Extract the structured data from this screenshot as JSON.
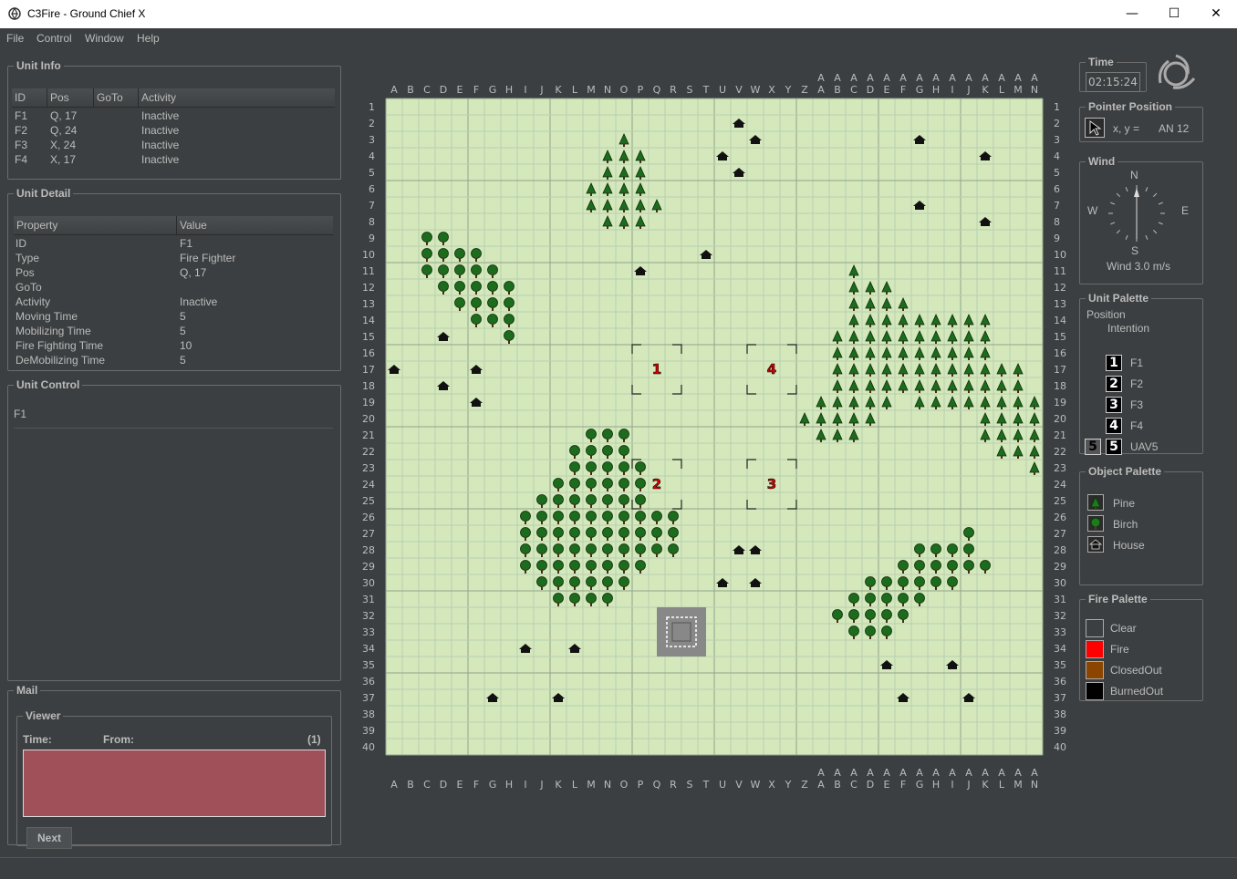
{
  "window": {
    "title": "C3Fire - Ground Chief X",
    "minimize_glyph": "—",
    "maximize_glyph": "☐",
    "close_glyph": "✕"
  },
  "menu": [
    "File",
    "Control",
    "Window",
    "Help"
  ],
  "unit_info": {
    "title": "Unit Info",
    "columns": [
      "ID",
      "Pos",
      "GoTo",
      "Activity"
    ],
    "rows": [
      [
        "F1",
        "Q, 17",
        "",
        "Inactive"
      ],
      [
        "F2",
        "Q, 24",
        "",
        "Inactive"
      ],
      [
        "F3",
        "X, 24",
        "",
        "Inactive"
      ],
      [
        "F4",
        "X, 17",
        "",
        "Inactive"
      ]
    ]
  },
  "unit_detail": {
    "title": "Unit Detail",
    "columns": [
      "Property",
      "Value"
    ],
    "rows": [
      [
        "ID",
        "F1"
      ],
      [
        "Type",
        "Fire Fighter"
      ],
      [
        "Pos",
        "Q, 17"
      ],
      [
        "GoTo",
        ""
      ],
      [
        "Activity",
        "Inactive"
      ],
      [
        "Moving Time",
        "5"
      ],
      [
        "Mobilizing Time",
        "5"
      ],
      [
        "Fire Fighting Time",
        "10"
      ],
      [
        "DeMobilizing Time",
        "5"
      ]
    ]
  },
  "unit_control": {
    "title": "Unit Control",
    "unit": "F1"
  },
  "mail": {
    "title": "Mail",
    "viewer_title": "Viewer",
    "time_label": "Time:",
    "from_label": "From:",
    "count": "(1)",
    "next_label": "Next"
  },
  "time_panel": {
    "title": "Time",
    "value": "02:15:24"
  },
  "pointer_position": {
    "title": "Pointer Position",
    "label": "x, y =",
    "value": "AN 12"
  },
  "wind": {
    "title": "Wind",
    "n": "N",
    "s": "S",
    "e": "E",
    "w": "W",
    "speed": "Wind 3.0 m/s"
  },
  "unit_palette": {
    "title": "Unit Palette",
    "position_label": "Position",
    "intention_label": "Intention",
    "units": [
      {
        "num": "1",
        "label": "F1"
      },
      {
        "num": "2",
        "label": "F2"
      },
      {
        "num": "3",
        "label": "F3"
      },
      {
        "num": "4",
        "label": "F4"
      },
      {
        "num": "5",
        "label": "UAV5"
      }
    ]
  },
  "object_palette": {
    "title": "Object Palette",
    "items": [
      {
        "label": "Pine",
        "icon": "pine-icon"
      },
      {
        "label": "Birch",
        "icon": "birch-icon"
      },
      {
        "label": "House",
        "icon": "house-icon"
      }
    ]
  },
  "fire_palette": {
    "title": "Fire Palette",
    "items": [
      {
        "label": "Clear",
        "color": "#3c3f41"
      },
      {
        "label": "Fire",
        "color": "#ff0000"
      },
      {
        "label": "ClosedOut",
        "color": "#8b4500"
      },
      {
        "label": "BurnedOut",
        "color": "#000000"
      }
    ]
  },
  "map": {
    "columns": [
      "A",
      "B",
      "C",
      "D",
      "E",
      "F",
      "G",
      "H",
      "I",
      "J",
      "K",
      "L",
      "M",
      "N",
      "O",
      "P",
      "Q",
      "R",
      "S",
      "T",
      "U",
      "V",
      "W",
      "X",
      "Y",
      "Z",
      "AA",
      "AB",
      "AC",
      "AD",
      "AE",
      "AF",
      "AG",
      "AH",
      "AI",
      "AJ",
      "AK",
      "AL",
      "AM",
      "AN"
    ],
    "rows": 40,
    "ground_color": "#d4e8bc",
    "pines": [
      [
        15,
        3
      ],
      [
        14,
        4
      ],
      [
        15,
        4
      ],
      [
        16,
        4
      ],
      [
        14,
        5
      ],
      [
        15,
        5
      ],
      [
        16,
        5
      ],
      [
        13,
        6
      ],
      [
        14,
        6
      ],
      [
        15,
        6
      ],
      [
        16,
        6
      ],
      [
        13,
        7
      ],
      [
        14,
        7
      ],
      [
        15,
        7
      ],
      [
        16,
        7
      ],
      [
        17,
        7
      ],
      [
        14,
        8
      ],
      [
        15,
        8
      ],
      [
        16,
        8
      ],
      [
        29,
        11
      ],
      [
        29,
        12
      ],
      [
        30,
        12
      ],
      [
        31,
        12
      ],
      [
        29,
        13
      ],
      [
        30,
        13
      ],
      [
        31,
        13
      ],
      [
        32,
        13
      ],
      [
        29,
        14
      ],
      [
        30,
        14
      ],
      [
        31,
        14
      ],
      [
        32,
        14
      ],
      [
        33,
        14
      ],
      [
        34,
        14
      ],
      [
        35,
        14
      ],
      [
        36,
        14
      ],
      [
        37,
        14
      ],
      [
        28,
        15
      ],
      [
        29,
        15
      ],
      [
        30,
        15
      ],
      [
        31,
        15
      ],
      [
        32,
        15
      ],
      [
        33,
        15
      ],
      [
        34,
        15
      ],
      [
        35,
        15
      ],
      [
        36,
        15
      ],
      [
        37,
        15
      ],
      [
        28,
        16
      ],
      [
        29,
        16
      ],
      [
        30,
        16
      ],
      [
        31,
        16
      ],
      [
        32,
        16
      ],
      [
        33,
        16
      ],
      [
        34,
        16
      ],
      [
        35,
        16
      ],
      [
        36,
        16
      ],
      [
        37,
        16
      ],
      [
        28,
        17
      ],
      [
        29,
        17
      ],
      [
        30,
        17
      ],
      [
        31,
        17
      ],
      [
        32,
        17
      ],
      [
        33,
        17
      ],
      [
        34,
        17
      ],
      [
        35,
        17
      ],
      [
        36,
        17
      ],
      [
        37,
        17
      ],
      [
        38,
        17
      ],
      [
        39,
        17
      ],
      [
        28,
        18
      ],
      [
        29,
        18
      ],
      [
        30,
        18
      ],
      [
        31,
        18
      ],
      [
        32,
        18
      ],
      [
        33,
        18
      ],
      [
        34,
        18
      ],
      [
        35,
        18
      ],
      [
        36,
        18
      ],
      [
        37,
        18
      ],
      [
        38,
        18
      ],
      [
        39,
        18
      ],
      [
        27,
        19
      ],
      [
        28,
        19
      ],
      [
        29,
        19
      ],
      [
        30,
        19
      ],
      [
        31,
        19
      ],
      [
        33,
        19
      ],
      [
        34,
        19
      ],
      [
        35,
        19
      ],
      [
        36,
        19
      ],
      [
        37,
        19
      ],
      [
        38,
        19
      ],
      [
        39,
        19
      ],
      [
        40,
        19
      ],
      [
        26,
        20
      ],
      [
        27,
        20
      ],
      [
        28,
        20
      ],
      [
        29,
        20
      ],
      [
        30,
        20
      ],
      [
        37,
        20
      ],
      [
        38,
        20
      ],
      [
        39,
        20
      ],
      [
        40,
        20
      ],
      [
        27,
        21
      ],
      [
        28,
        21
      ],
      [
        29,
        21
      ],
      [
        37,
        21
      ],
      [
        38,
        21
      ],
      [
        39,
        21
      ],
      [
        40,
        21
      ],
      [
        38,
        22
      ],
      [
        39,
        22
      ],
      [
        40,
        22
      ],
      [
        40,
        23
      ]
    ],
    "birches": [
      [
        3,
        9
      ],
      [
        4,
        9
      ],
      [
        3,
        10
      ],
      [
        4,
        10
      ],
      [
        5,
        10
      ],
      [
        6,
        10
      ],
      [
        3,
        11
      ],
      [
        4,
        11
      ],
      [
        5,
        11
      ],
      [
        6,
        11
      ],
      [
        7,
        11
      ],
      [
        4,
        12
      ],
      [
        5,
        12
      ],
      [
        6,
        12
      ],
      [
        7,
        12
      ],
      [
        8,
        12
      ],
      [
        5,
        13
      ],
      [
        6,
        13
      ],
      [
        7,
        13
      ],
      [
        8,
        13
      ],
      [
        6,
        14
      ],
      [
        7,
        14
      ],
      [
        8,
        14
      ],
      [
        8,
        15
      ],
      [
        13,
        21
      ],
      [
        14,
        21
      ],
      [
        15,
        21
      ],
      [
        12,
        22
      ],
      [
        13,
        22
      ],
      [
        14,
        22
      ],
      [
        15,
        22
      ],
      [
        12,
        23
      ],
      [
        13,
        23
      ],
      [
        14,
        23
      ],
      [
        15,
        23
      ],
      [
        16,
        23
      ],
      [
        11,
        24
      ],
      [
        12,
        24
      ],
      [
        13,
        24
      ],
      [
        14,
        24
      ],
      [
        15,
        24
      ],
      [
        16,
        24
      ],
      [
        10,
        25
      ],
      [
        11,
        25
      ],
      [
        12,
        25
      ],
      [
        13,
        25
      ],
      [
        14,
        25
      ],
      [
        15,
        25
      ],
      [
        16,
        25
      ],
      [
        9,
        26
      ],
      [
        10,
        26
      ],
      [
        11,
        26
      ],
      [
        12,
        26
      ],
      [
        13,
        26
      ],
      [
        14,
        26
      ],
      [
        15,
        26
      ],
      [
        16,
        26
      ],
      [
        17,
        26
      ],
      [
        18,
        26
      ],
      [
        9,
        27
      ],
      [
        10,
        27
      ],
      [
        11,
        27
      ],
      [
        12,
        27
      ],
      [
        13,
        27
      ],
      [
        14,
        27
      ],
      [
        15,
        27
      ],
      [
        16,
        27
      ],
      [
        17,
        27
      ],
      [
        18,
        27
      ],
      [
        9,
        28
      ],
      [
        10,
        28
      ],
      [
        11,
        28
      ],
      [
        12,
        28
      ],
      [
        13,
        28
      ],
      [
        14,
        28
      ],
      [
        15,
        28
      ],
      [
        16,
        28
      ],
      [
        17,
        28
      ],
      [
        18,
        28
      ],
      [
        9,
        29
      ],
      [
        10,
        29
      ],
      [
        11,
        29
      ],
      [
        12,
        29
      ],
      [
        13,
        29
      ],
      [
        14,
        29
      ],
      [
        15,
        29
      ],
      [
        16,
        29
      ],
      [
        10,
        30
      ],
      [
        11,
        30
      ],
      [
        12,
        30
      ],
      [
        13,
        30
      ],
      [
        14,
        30
      ],
      [
        15,
        30
      ],
      [
        11,
        31
      ],
      [
        12,
        31
      ],
      [
        13,
        31
      ],
      [
        14,
        31
      ],
      [
        36,
        27
      ],
      [
        33,
        28
      ],
      [
        34,
        28
      ],
      [
        35,
        28
      ],
      [
        36,
        28
      ],
      [
        32,
        29
      ],
      [
        33,
        29
      ],
      [
        34,
        29
      ],
      [
        35,
        29
      ],
      [
        36,
        29
      ],
      [
        37,
        29
      ],
      [
        30,
        30
      ],
      [
        31,
        30
      ],
      [
        32,
        30
      ],
      [
        33,
        30
      ],
      [
        34,
        30
      ],
      [
        35,
        30
      ],
      [
        29,
        31
      ],
      [
        30,
        31
      ],
      [
        31,
        31
      ],
      [
        32,
        31
      ],
      [
        33,
        31
      ],
      [
        28,
        32
      ],
      [
        29,
        32
      ],
      [
        30,
        32
      ],
      [
        31,
        32
      ],
      [
        32,
        32
      ],
      [
        29,
        33
      ],
      [
        30,
        33
      ],
      [
        31,
        33
      ]
    ],
    "houses": [
      [
        22,
        2
      ],
      [
        23,
        3
      ],
      [
        33,
        3
      ],
      [
        21,
        4
      ],
      [
        37,
        4
      ],
      [
        22,
        5
      ],
      [
        33,
        7
      ],
      [
        37,
        8
      ],
      [
        20,
        10
      ],
      [
        16,
        11
      ],
      [
        4,
        15
      ],
      [
        1,
        17
      ],
      [
        6,
        17
      ],
      [
        4,
        18
      ],
      [
        6,
        19
      ],
      [
        22,
        28
      ],
      [
        23,
        28
      ],
      [
        21,
        30
      ],
      [
        23,
        30
      ],
      [
        9,
        34
      ],
      [
        12,
        34
      ],
      [
        31,
        35
      ],
      [
        35,
        35
      ],
      [
        7,
        37
      ],
      [
        11,
        37
      ],
      [
        32,
        37
      ],
      [
        36,
        37
      ]
    ],
    "units": [
      {
        "num": "1",
        "col": 17,
        "row": 17
      },
      {
        "num": "4",
        "col": 24,
        "row": 17
      },
      {
        "num": "2",
        "col": 17,
        "row": 24
      },
      {
        "num": "3",
        "col": 24,
        "row": 24
      }
    ],
    "uav": {
      "col": 18,
      "row": 33
    }
  }
}
